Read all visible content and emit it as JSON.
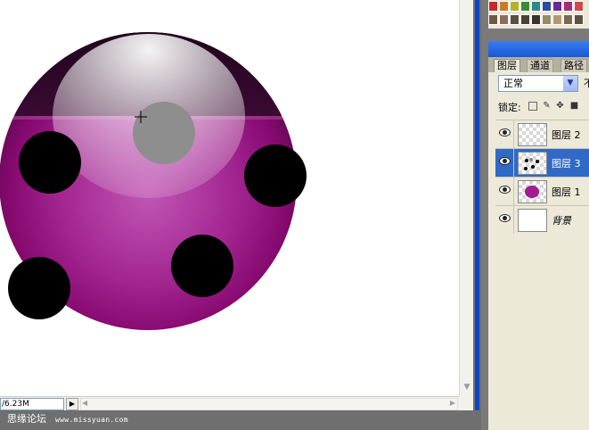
{
  "document": {
    "zoom_readout": "/6.23M"
  },
  "watermark": {
    "site_name": "思缘论坛",
    "url": "www.missyuan.com"
  },
  "layers_panel": {
    "tabs": [
      {
        "label": "图层"
      },
      {
        "label": "通道"
      },
      {
        "label": "路径"
      }
    ],
    "blend_mode": "正常",
    "opacity_label": "不透",
    "lock_label": "锁定:",
    "layers": [
      {
        "name": "图层 2",
        "visible": true,
        "selected": false
      },
      {
        "name": "图层 3",
        "visible": true,
        "selected": true
      },
      {
        "name": "图层 1",
        "visible": true,
        "selected": false
      },
      {
        "name": "背景",
        "visible": true,
        "selected": false
      }
    ]
  },
  "colors": {
    "accent_blue": "#0b46c8",
    "selection_blue": "#3169c6",
    "ball_magenta": "#9a1a8e"
  },
  "icons": {
    "eye": "eye-icon",
    "lock_transparency": "lock-transparency-icon",
    "lock_paint": "brush-icon",
    "lock_move": "move-icon",
    "lock_all": "padlock-icon",
    "crosshair": "crosshair-cursor-icon"
  }
}
